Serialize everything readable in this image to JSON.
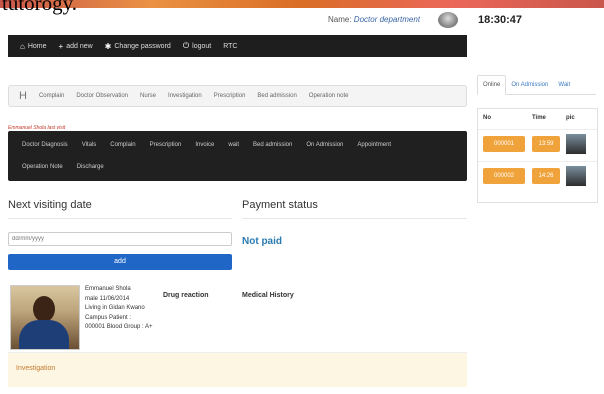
{
  "caption": "tutorogy.",
  "header": {
    "department_label": "Name:",
    "department": "Doctor department",
    "clock": "18:30:47"
  },
  "nav": [
    {
      "label": "Home",
      "icon": "home-icon"
    },
    {
      "label": "add new",
      "icon": "plus-icon"
    },
    {
      "label": "Change password",
      "icon": "gear-icon"
    },
    {
      "label": "logout",
      "icon": "power-icon"
    },
    {
      "label": "RTC",
      "icon": ""
    }
  ],
  "breadcrumb": {
    "letter": "H",
    "items": [
      "Complain",
      "Doctor Observation",
      "Nurse",
      "Investigation",
      "Prescription",
      "Bed admission",
      "Operation note"
    ]
  },
  "patient_hint": "Emmanuel Shola last visit",
  "menu": {
    "row1": [
      "Doctor Diagnosis",
      "Vitals",
      "Complain",
      "Prescription",
      "Invoice",
      "wait",
      "Bed admission",
      "On Admission",
      "Appointment"
    ],
    "row2": [
      "Operation Note",
      "Discharge"
    ]
  },
  "visit": {
    "title": "Next visiting date",
    "placeholder": "dd/mm/yyyy",
    "button": "add"
  },
  "payment": {
    "title": "Payment status",
    "status": "Not paid"
  },
  "patient": {
    "name": "Emmanuel Shola",
    "line2": "male 11/06/2014",
    "line3": "Living in Gidan Kwano",
    "line4": "Campus Patient :",
    "line5": "000001 Blood Group : A+"
  },
  "drug_reaction": "Drug reaction",
  "medical_history": "Medical History",
  "investigation": "Investigation",
  "right_panel": {
    "tabs": [
      "Online",
      "On Admission",
      "Wait"
    ],
    "headers": [
      "No",
      "Time",
      "pic"
    ],
    "rows": [
      {
        "no": "000001",
        "time": "13:59"
      },
      {
        "no": "000002",
        "time": "14:26"
      }
    ]
  }
}
